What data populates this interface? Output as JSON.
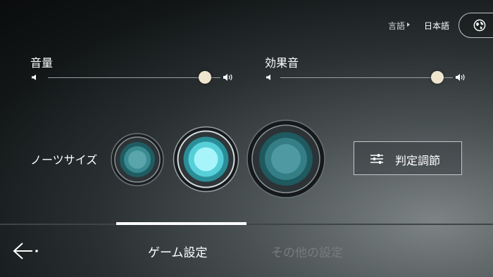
{
  "header": {
    "language_label": "言語",
    "language_value": "日本語",
    "language_icon": "globe-icon"
  },
  "volume": {
    "label": "音量",
    "value": 0.91,
    "low_icon": "volume-low-icon",
    "high_icon": "volume-high-icon"
  },
  "sound_effects": {
    "label": "効果音",
    "value": 0.91,
    "low_icon": "volume-low-icon",
    "high_icon": "volume-high-icon"
  },
  "note_size": {
    "label": "ノーツサイズ",
    "options": [
      "small",
      "medium",
      "large"
    ],
    "selected": "medium"
  },
  "judge_button": {
    "label": "判定調節",
    "icon": "sliders-icon"
  },
  "tabs": [
    {
      "label": "ゲーム設定",
      "active": true
    },
    {
      "label": "その他の設定",
      "active": false
    }
  ],
  "back_icon": "back-arrow-icon",
  "colors": {
    "accent_thumb": "#efe6cf",
    "note_glow": "#7fe8f0",
    "inactive_tab": "#767c7d"
  }
}
